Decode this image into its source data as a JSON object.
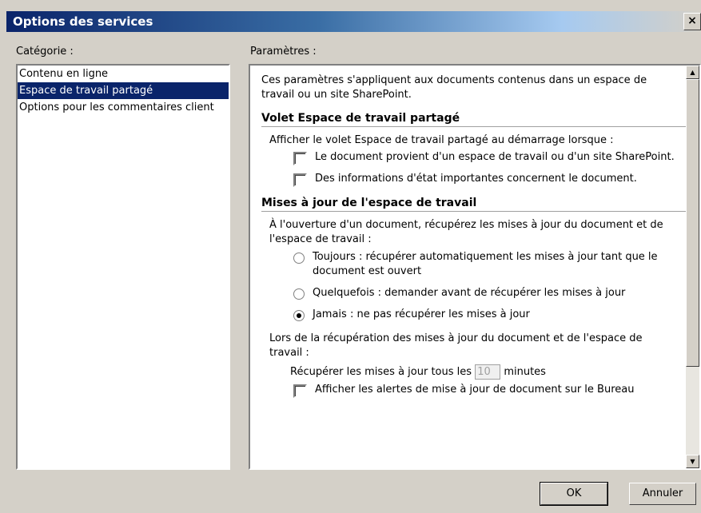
{
  "window": {
    "title": "Options des services",
    "close_glyph": "×"
  },
  "category_label": "Catégorie :",
  "categories": [
    "Contenu en ligne",
    "Espace de travail partagé",
    "Options pour les commentaires client"
  ],
  "selected_category": 1,
  "settings_label": "Paramètres :",
  "settings": {
    "intro": "Ces paramètres s'appliquent aux documents contenus dans un espace de travail ou un site SharePoint.",
    "section1": {
      "title": "Volet Espace de travail partagé",
      "lead": "Afficher le volet Espace de travail partagé au démarrage lorsque :",
      "checkbox1": "Le document provient d'un espace de travail ou d'un site SharePoint.",
      "checkbox2": "Des informations d'état importantes concernent le document."
    },
    "section2": {
      "title": "Mises à jour de l'espace de travail",
      "lead": "À l'ouverture d'un document, récupérez les mises à jour du document et de l'espace de travail :",
      "radio1": "Toujours : récupérer automatiquement les mises à jour tant que le document est ouvert",
      "radio2": "Quelquefois : demander avant de récupérer les mises à jour",
      "radio3": "Jamais : ne pas récupérer les mises à jour",
      "selected_radio": 3,
      "lead2": "Lors de la récupération des mises à jour du document et de l'espace de travail :",
      "interval_prefix": "Récupérer les mises à jour tous les",
      "interval_value": "10",
      "interval_suffix": "minutes",
      "checkbox3": "Afficher les alertes de mise à jour de document sur le Bureau"
    }
  },
  "buttons": {
    "ok": "OK",
    "cancel": "Annuler"
  }
}
